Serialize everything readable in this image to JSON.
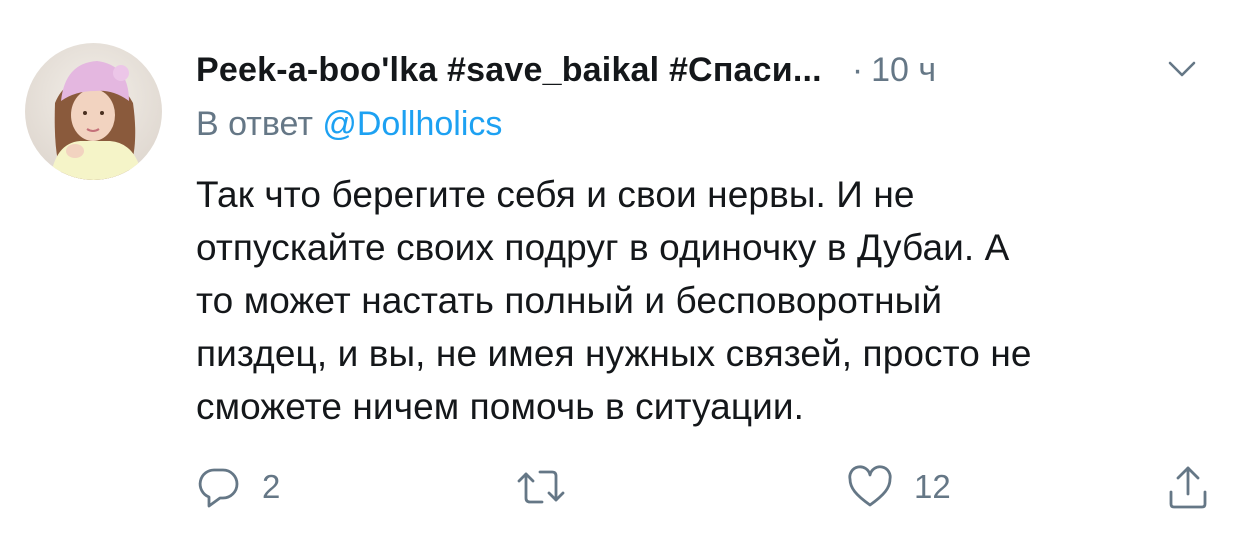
{
  "tweet": {
    "author": {
      "display_name": "Peek-a-boo'lka #save_baikal #Спаси...",
      "avatar": "avatar-photo"
    },
    "separator": "·",
    "time": "10 ч",
    "menu_icon": "chevron-down-icon",
    "reply_prefix": "В ответ",
    "reply_mention": "@Dollholics",
    "text_lines": [
      "Так что берегите себя и свои нервы. И не",
      "отпускайте своих подруг в одиночку в Дубаи. А",
      "то может настать полный и бесповоротный",
      "пиздец, и вы, не имея нужных связей, просто не",
      "сможете ничем помочь в  ситуации."
    ],
    "actions": {
      "reply": {
        "icon": "reply-icon",
        "count": "2"
      },
      "retweet": {
        "icon": "retweet-icon",
        "count": ""
      },
      "like": {
        "icon": "heart-icon",
        "count": "12"
      },
      "share": {
        "icon": "share-icon"
      }
    },
    "colors": {
      "text": "#14171a",
      "secondary": "#657786",
      "link": "#1da1f2"
    }
  }
}
